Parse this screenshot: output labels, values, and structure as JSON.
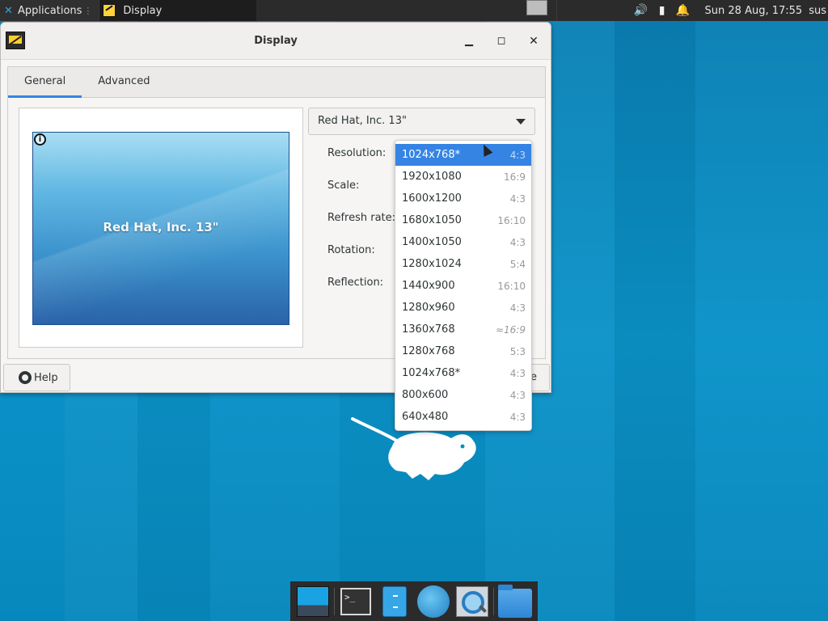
{
  "top_panel": {
    "applications_label": "Applications",
    "task_label": "Display",
    "clock": "Sun 28 Aug, 17:55",
    "user": "sus"
  },
  "window": {
    "title": "Display",
    "tabs": [
      {
        "label": "General",
        "active": true
      },
      {
        "label": "Advanced",
        "active": false
      }
    ],
    "preview_label": "Red Hat, Inc. 13\"",
    "display_selected": "Red Hat, Inc. 13\"",
    "fields": {
      "resolution": "Resolution:",
      "scale": "Scale:",
      "refresh_rate": "Refresh rate:",
      "rotation": "Rotation:",
      "reflection": "Reflection:"
    },
    "help_label": "Help",
    "close_label_partial": "e"
  },
  "resolution_menu": {
    "items": [
      {
        "res": "1024x768*",
        "ratio": "4:3",
        "selected": true
      },
      {
        "res": "1920x1080",
        "ratio": "16:9"
      },
      {
        "res": "1600x1200",
        "ratio": "4:3"
      },
      {
        "res": "1680x1050",
        "ratio": "16:10"
      },
      {
        "res": "1400x1050",
        "ratio": "4:3"
      },
      {
        "res": "1280x1024",
        "ratio": "5:4"
      },
      {
        "res": "1440x900",
        "ratio": "16:10"
      },
      {
        "res": "1280x960",
        "ratio": "4:3"
      },
      {
        "res": "1360x768",
        "ratio": "≈16:9"
      },
      {
        "res": "1280x768",
        "ratio": "5:3"
      },
      {
        "res": "1024x768*",
        "ratio": "4:3"
      },
      {
        "res": "800x600",
        "ratio": "4:3"
      },
      {
        "res": "640x480",
        "ratio": "4:3"
      }
    ]
  },
  "dock": {
    "items": [
      "desktop-icon",
      "terminal-icon",
      "file-manager-icon",
      "web-browser-icon",
      "app-finder-icon",
      "home-folder-icon"
    ]
  },
  "colors": {
    "accent": "#3584e4",
    "desktop": "#0a8fc4",
    "panel": "#2b2b2b"
  }
}
